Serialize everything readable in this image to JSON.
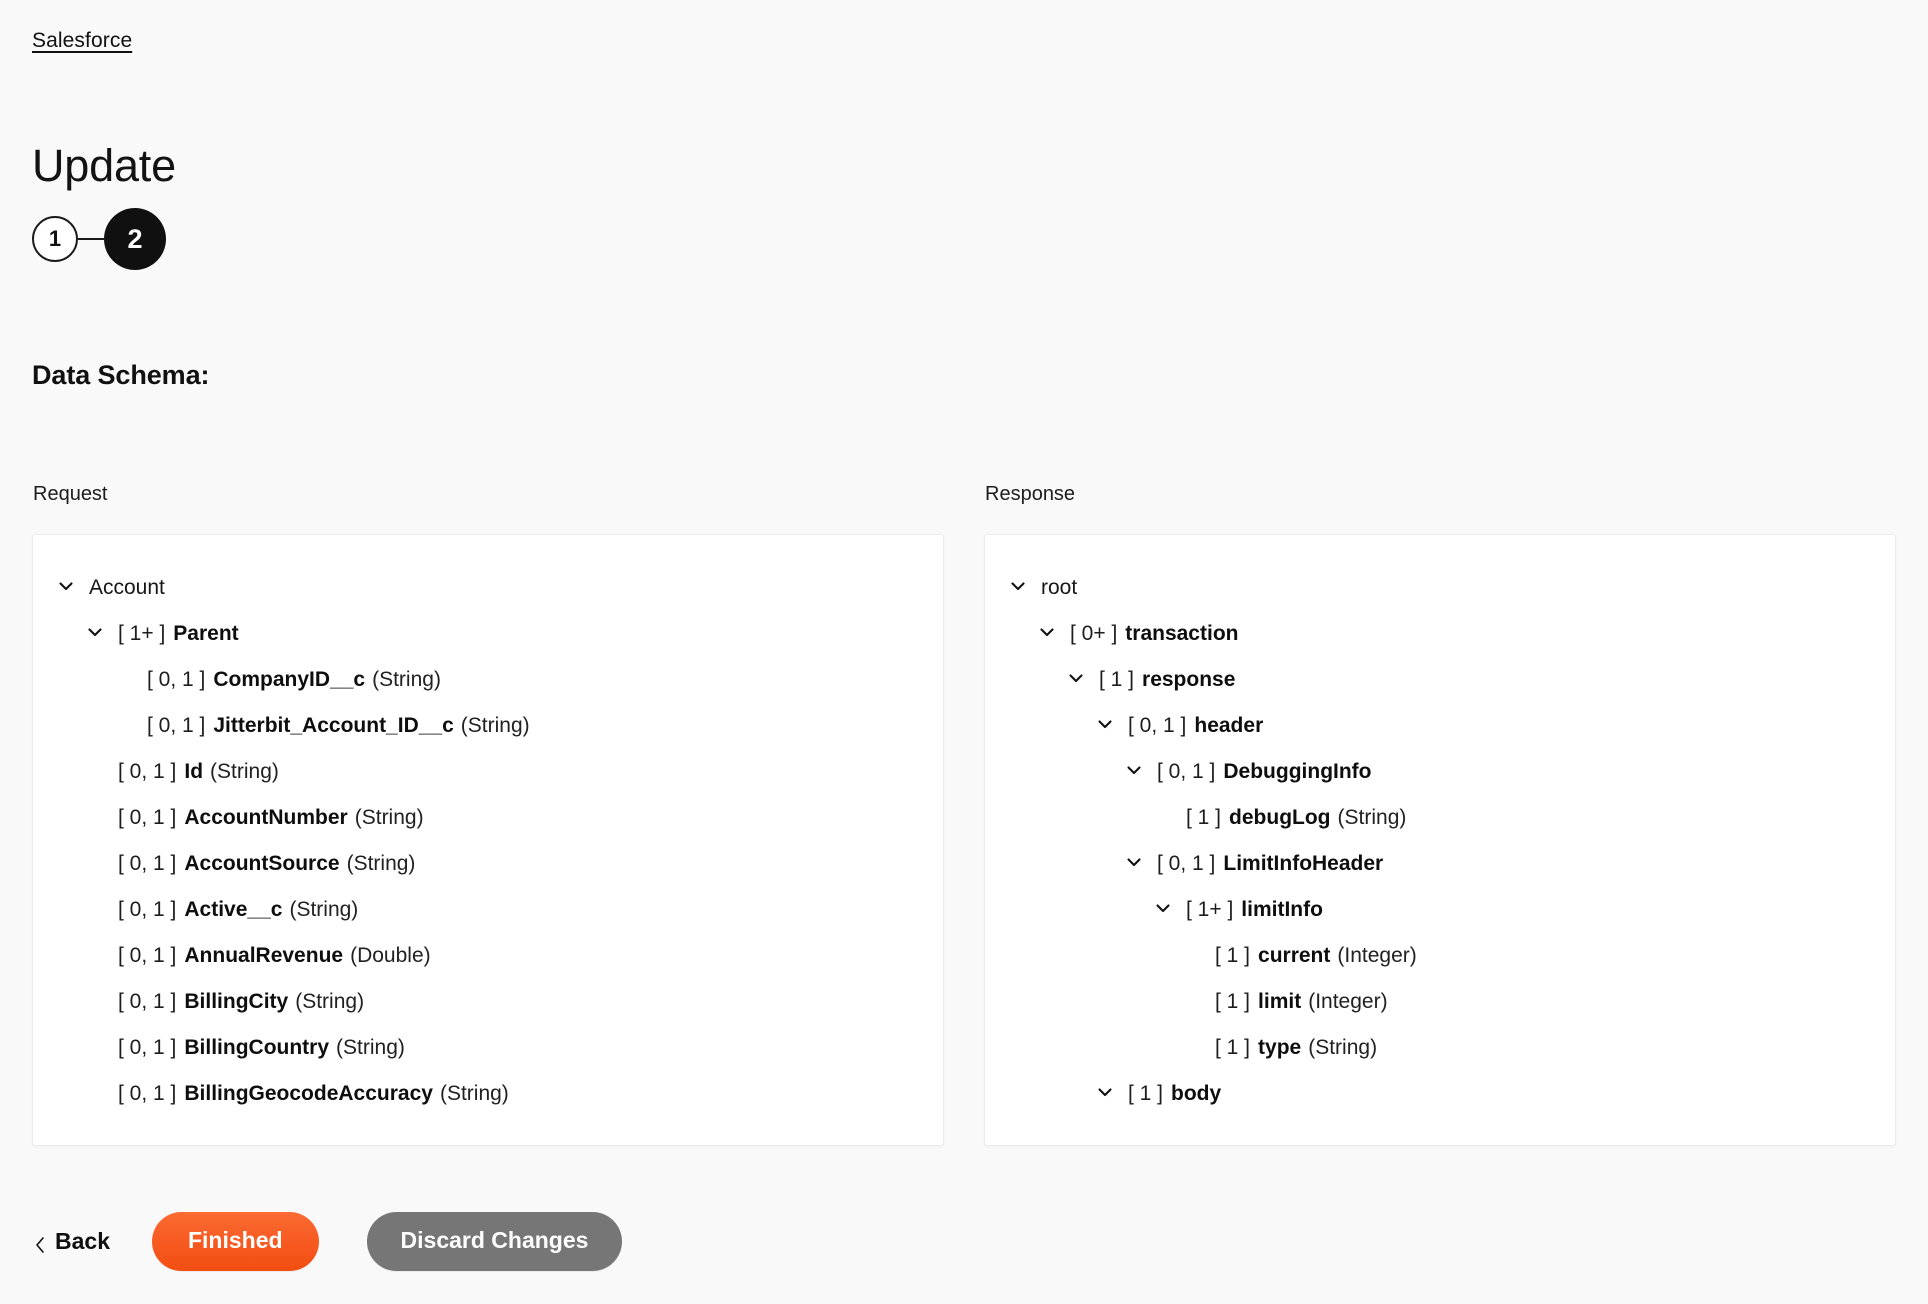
{
  "breadcrumb": {
    "label": "Salesforce"
  },
  "page_title": "Update",
  "stepper": {
    "steps": [
      {
        "label": "1",
        "state": "inactive"
      },
      {
        "label": "2",
        "state": "active"
      }
    ]
  },
  "section": {
    "heading": "Data Schema:"
  },
  "schema": {
    "request": {
      "label": "Request",
      "nodes": [
        {
          "depth": 0,
          "expandable": true,
          "expanded": true,
          "occurrence": "",
          "name": "Account",
          "type": "",
          "bold": false
        },
        {
          "depth": 1,
          "expandable": true,
          "expanded": true,
          "occurrence": "[ 1+ ]",
          "name": "Parent",
          "type": "",
          "bold": true
        },
        {
          "depth": 2,
          "expandable": false,
          "expanded": false,
          "occurrence": "[ 0, 1 ]",
          "name": "CompanyID__c",
          "type": "(String)",
          "bold": true
        },
        {
          "depth": 2,
          "expandable": false,
          "expanded": false,
          "occurrence": "[ 0, 1 ]",
          "name": "Jitterbit_Account_ID__c",
          "type": "(String)",
          "bold": true
        },
        {
          "depth": 1,
          "expandable": false,
          "expanded": false,
          "occurrence": "[ 0, 1 ]",
          "name": "Id",
          "type": "(String)",
          "bold": true
        },
        {
          "depth": 1,
          "expandable": false,
          "expanded": false,
          "occurrence": "[ 0, 1 ]",
          "name": "AccountNumber",
          "type": "(String)",
          "bold": true
        },
        {
          "depth": 1,
          "expandable": false,
          "expanded": false,
          "occurrence": "[ 0, 1 ]",
          "name": "AccountSource",
          "type": "(String)",
          "bold": true
        },
        {
          "depth": 1,
          "expandable": false,
          "expanded": false,
          "occurrence": "[ 0, 1 ]",
          "name": "Active__c",
          "type": "(String)",
          "bold": true
        },
        {
          "depth": 1,
          "expandable": false,
          "expanded": false,
          "occurrence": "[ 0, 1 ]",
          "name": "AnnualRevenue",
          "type": "(Double)",
          "bold": true
        },
        {
          "depth": 1,
          "expandable": false,
          "expanded": false,
          "occurrence": "[ 0, 1 ]",
          "name": "BillingCity",
          "type": "(String)",
          "bold": true
        },
        {
          "depth": 1,
          "expandable": false,
          "expanded": false,
          "occurrence": "[ 0, 1 ]",
          "name": "BillingCountry",
          "type": "(String)",
          "bold": true
        },
        {
          "depth": 1,
          "expandable": false,
          "expanded": false,
          "occurrence": "[ 0, 1 ]",
          "name": "BillingGeocodeAccuracy",
          "type": "(String)",
          "bold": true
        }
      ]
    },
    "response": {
      "label": "Response",
      "nodes": [
        {
          "depth": 0,
          "expandable": true,
          "expanded": true,
          "occurrence": "",
          "name": "root",
          "type": "",
          "bold": false
        },
        {
          "depth": 1,
          "expandable": true,
          "expanded": true,
          "occurrence": "[ 0+ ]",
          "name": "transaction",
          "type": "",
          "bold": true
        },
        {
          "depth": 2,
          "expandable": true,
          "expanded": true,
          "occurrence": "[ 1 ]",
          "name": "response",
          "type": "",
          "bold": true
        },
        {
          "depth": 3,
          "expandable": true,
          "expanded": true,
          "occurrence": "[ 0, 1 ]",
          "name": "header",
          "type": "",
          "bold": true
        },
        {
          "depth": 4,
          "expandable": true,
          "expanded": true,
          "occurrence": "[ 0, 1 ]",
          "name": "DebuggingInfo",
          "type": "",
          "bold": true
        },
        {
          "depth": 5,
          "expandable": false,
          "expanded": false,
          "occurrence": "[ 1 ]",
          "name": "debugLog",
          "type": "(String)",
          "bold": true
        },
        {
          "depth": 4,
          "expandable": true,
          "expanded": true,
          "occurrence": "[ 0, 1 ]",
          "name": "LimitInfoHeader",
          "type": "",
          "bold": true
        },
        {
          "depth": 5,
          "expandable": true,
          "expanded": true,
          "occurrence": "[ 1+ ]",
          "name": "limitInfo",
          "type": "",
          "bold": true
        },
        {
          "depth": 6,
          "expandable": false,
          "expanded": false,
          "occurrence": "[ 1 ]",
          "name": "current",
          "type": "(Integer)",
          "bold": true
        },
        {
          "depth": 6,
          "expandable": false,
          "expanded": false,
          "occurrence": "[ 1 ]",
          "name": "limit",
          "type": "(Integer)",
          "bold": true
        },
        {
          "depth": 6,
          "expandable": false,
          "expanded": false,
          "occurrence": "[ 1 ]",
          "name": "type",
          "type": "(String)",
          "bold": true
        },
        {
          "depth": 3,
          "expandable": true,
          "expanded": true,
          "occurrence": "[ 1 ]",
          "name": "body",
          "type": "",
          "bold": true
        }
      ]
    }
  },
  "footer": {
    "back_label": "Back",
    "finished_label": "Finished",
    "discard_label": "Discard Changes"
  },
  "colors": {
    "accent_orange": "#f75c23",
    "secondary_gray": "#767676",
    "page_background": "#f9f9f9",
    "panel_background": "#ffffff",
    "text": "#111111"
  }
}
